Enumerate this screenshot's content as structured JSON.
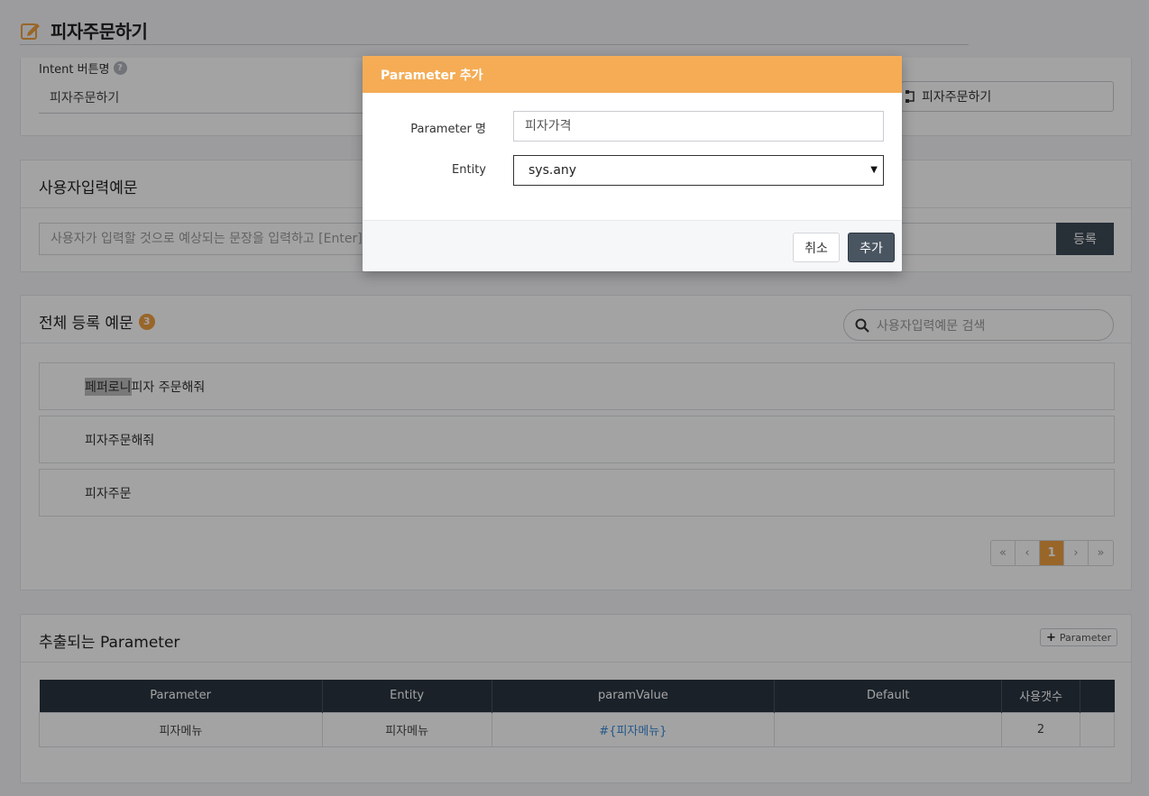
{
  "page": {
    "title": "피자주문하기"
  },
  "intent": {
    "label": "Intent 버튼명",
    "help": "?",
    "value": "피자주문하기",
    "button_label": "피자주문하기"
  },
  "utterance_input": {
    "title": "사용자입력예문",
    "placeholder": "사용자가 입력할 것으로 예상되는 문장을 입력하고 [Enter] 를",
    "register_label": "등록"
  },
  "all_utterances": {
    "title": "전체 등록 예문",
    "count": "3",
    "search_placeholder": "사용자입력예문 검색",
    "items": [
      {
        "highlight": "페퍼로니",
        "text": " 피자 주문해줘"
      },
      {
        "highlight": "",
        "text": "피자주문해줘"
      },
      {
        "highlight": "",
        "text": "피자주문"
      }
    ],
    "pagination": {
      "first": "«",
      "prev": "‹",
      "current": "1",
      "next": "›",
      "last": "»"
    }
  },
  "parameters": {
    "title": "추출되는 Parameter",
    "add_label": "Parameter",
    "columns": [
      "Parameter",
      "Entity",
      "paramValue",
      "Default",
      "사용갯수",
      ""
    ],
    "rows": [
      [
        "피자메뉴",
        "피자메뉴",
        "#{피자메뉴}",
        "",
        "2",
        ""
      ]
    ]
  },
  "modal": {
    "title": "Parameter 추가",
    "name_label": "Parameter 명",
    "name_value": "피자가격",
    "entity_label": "Entity",
    "entity_value": "sys.any",
    "cancel_label": "취소",
    "add_label": "추가"
  },
  "colors": {
    "accent": "#f5ac55",
    "dark": "#2a3440",
    "badge": "#f0a040",
    "link": "#3a8ad8"
  }
}
